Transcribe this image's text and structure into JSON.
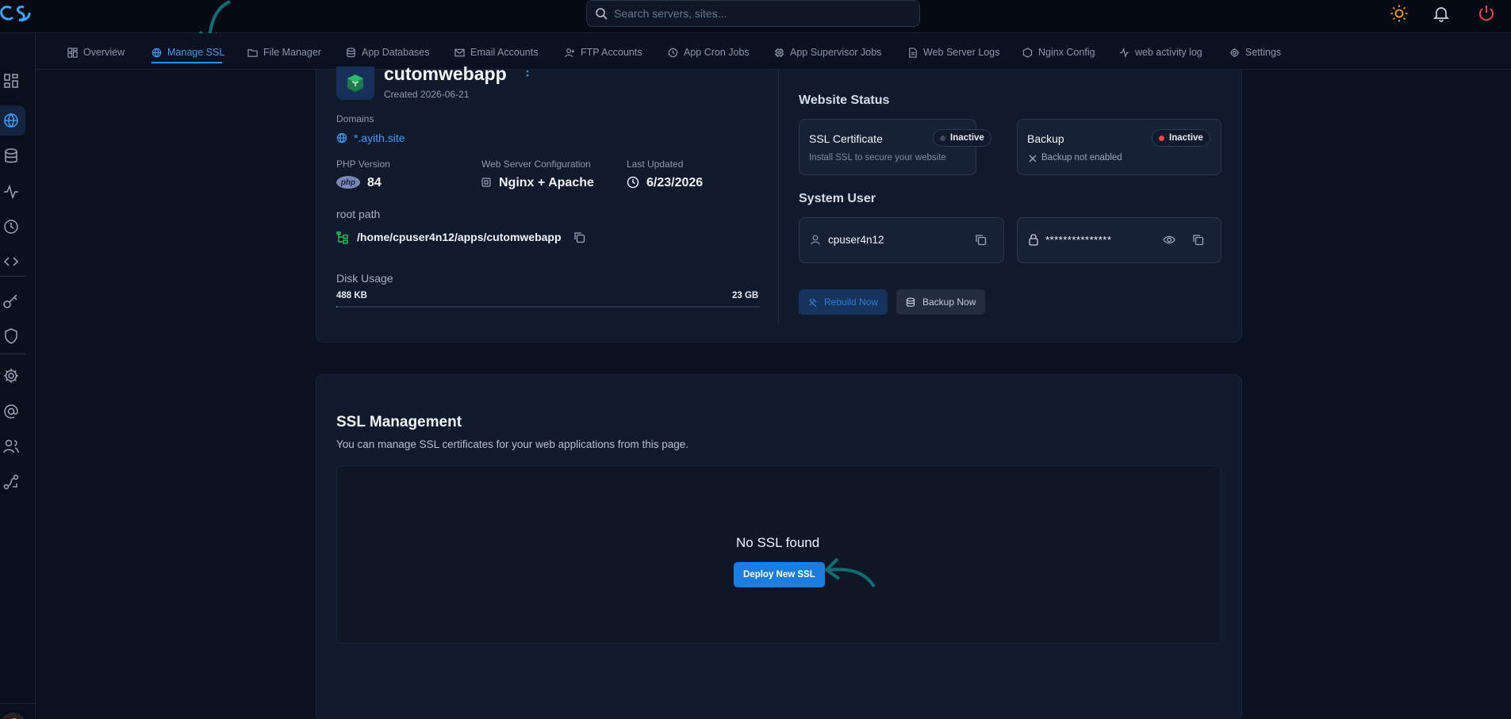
{
  "search": {
    "placeholder": "Search servers, sites..."
  },
  "tabs": [
    {
      "label": "Overview",
      "icon": "grid-icon"
    },
    {
      "label": "Manage SSL",
      "icon": "globe-icon"
    },
    {
      "label": "File Manager",
      "icon": "folder-icon"
    },
    {
      "label": "App Databases",
      "icon": "database-icon"
    },
    {
      "label": "Email Accounts",
      "icon": "mail-icon"
    },
    {
      "label": "FTP Accounts",
      "icon": "user-plus-icon"
    },
    {
      "label": "App Cron Jobs",
      "icon": "clock-icon"
    },
    {
      "label": "App Supervisor Jobs",
      "icon": "cpu-icon"
    },
    {
      "label": "Web Server Logs",
      "icon": "file-icon"
    },
    {
      "label": "Nginx Config",
      "icon": "hexagon-icon"
    },
    {
      "label": "web activity log",
      "icon": "activity-icon"
    },
    {
      "label": "Settings",
      "icon": "gear-icon"
    }
  ],
  "app": {
    "name": "cutomwebapp",
    "created": "Created 2026-06-21",
    "domains_label": "Domains",
    "domain": "*.ayith.site",
    "php_label": "PHP Version",
    "php_badge": "php",
    "php_version": "84",
    "webserver_label": "Web Server Configuration",
    "webserver": "Nginx + Apache",
    "updated_label": "Last Updated",
    "updated": "6/23/2026",
    "root_label": "root path",
    "root_path": "/home/cpuser4n12/apps/cutomwebapp",
    "disk_label": "Disk Usage",
    "disk_used": "488 KB",
    "disk_total": "23 GB",
    "disk_fraction": 2e-05
  },
  "website_status": {
    "title": "Website Status",
    "ssl": {
      "title": "SSL Certificate",
      "badge": "Inactive",
      "desc": "Install SSL to secure your website"
    },
    "backup": {
      "title": "Backup",
      "badge": "Inactive",
      "desc": "Backup not enabled"
    }
  },
  "system_user": {
    "title": "System User",
    "username": "cpuser4n12",
    "password": "***************"
  },
  "actions": {
    "rebuild": "Rebuild Now",
    "backup": "Backup Now"
  },
  "ssl_mgmt": {
    "title": "SSL Management",
    "desc": "You can manage SSL certificates for your web applications from this page.",
    "empty": "No SSL found",
    "deploy": "Deploy New SSL"
  },
  "colors": {
    "accent": "#2f8ff0",
    "inactive_dot_red": "#ef4444",
    "inactive_dot_gray": "#3f4a5e",
    "annotation_teal": "#0f6e72"
  }
}
